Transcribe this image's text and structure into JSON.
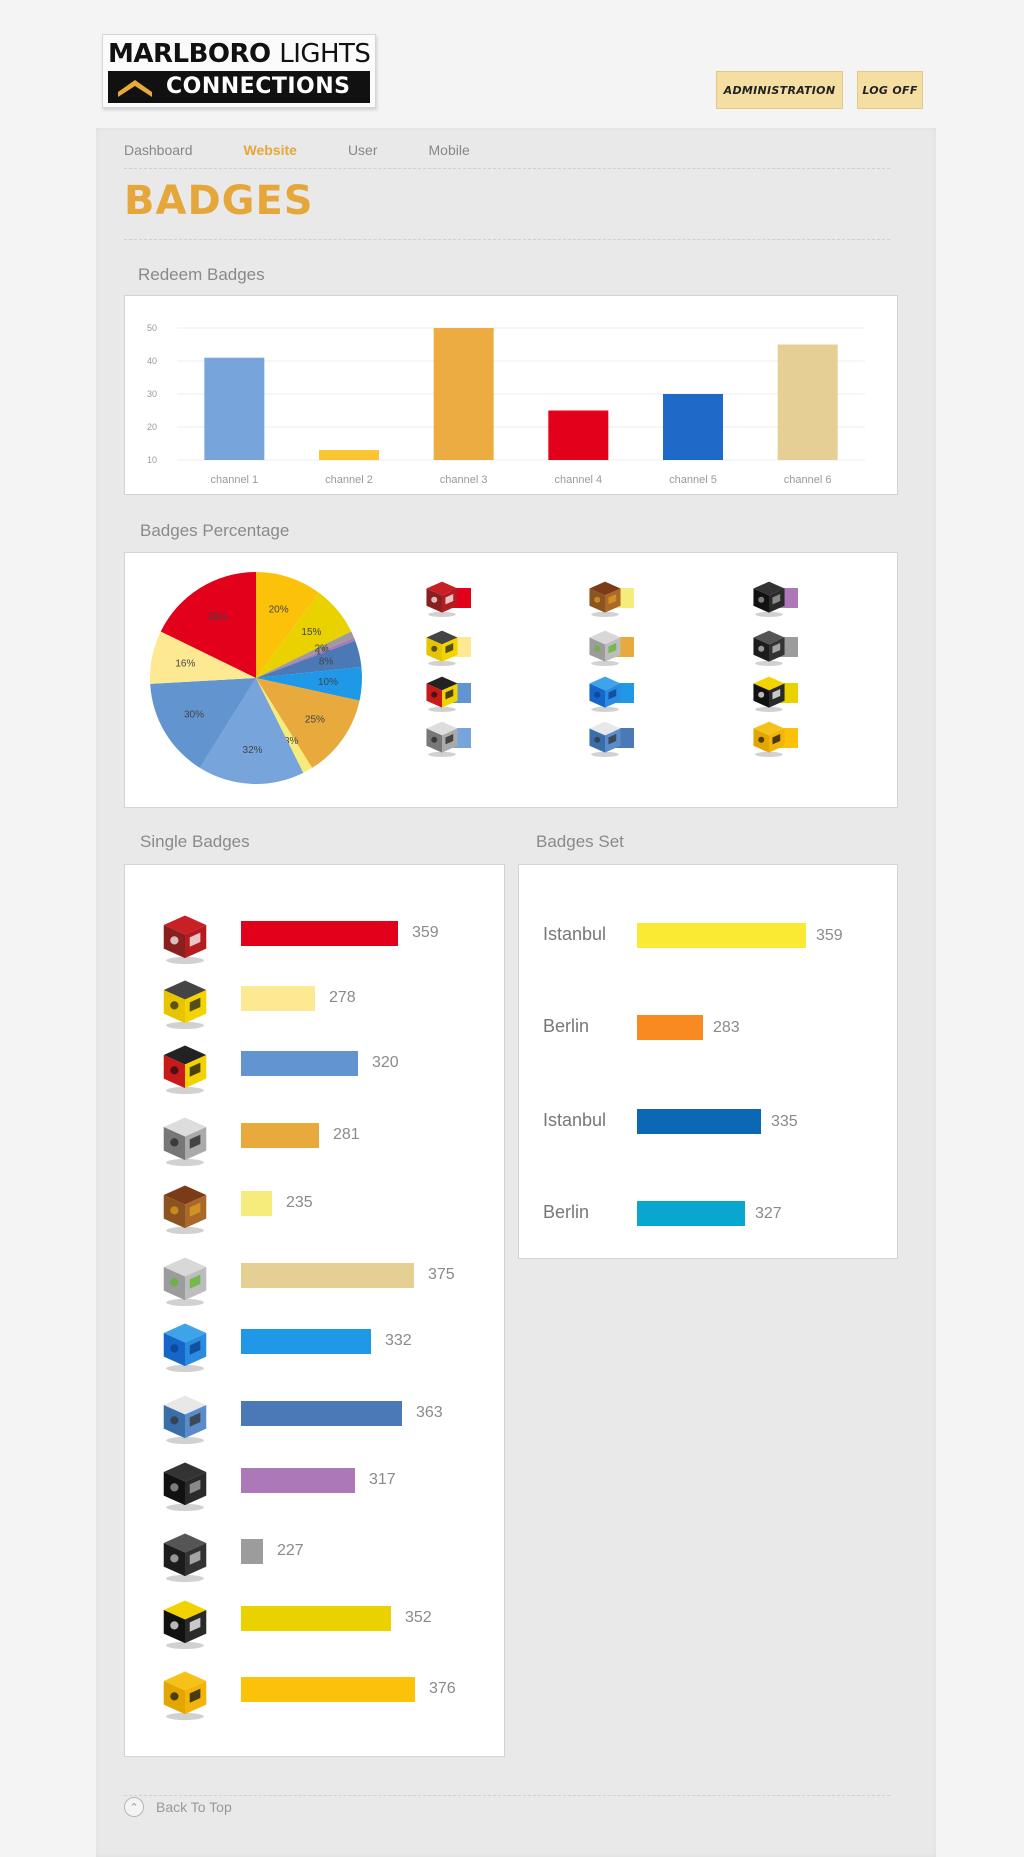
{
  "header": {
    "logo_line1_bold": "MARLBORO",
    "logo_line1_light": "LIGHTS",
    "logo_line2": "CONNECTIONS",
    "admin_label": "ADMINISTRATION",
    "logoff_label": "LOG OFF"
  },
  "nav": {
    "items": [
      {
        "label": "Dashboard",
        "active": false
      },
      {
        "label": "Website",
        "active": true
      },
      {
        "label": "User",
        "active": false
      },
      {
        "label": "Mobile",
        "active": false
      }
    ]
  },
  "page_title": "BADGES",
  "sections": {
    "redeem": "Redeem Badges",
    "percentage": "Badges Percentage",
    "single": "Single Badges",
    "set": "Badges Set"
  },
  "colors": {
    "accent": "#e5a73a",
    "red": "#e2001a",
    "light_yellow": "#fde991",
    "mid_blue": "#6294d0",
    "orange_gold": "#e8aa3c",
    "pale_yellow": "#f5ec7b",
    "tan": "#e5cf95",
    "sky_blue": "#1f98e8",
    "steel_blue": "#4a79b5",
    "purple": "#ad78b7",
    "gray": "#9c9c9c",
    "mustard": "#ead100",
    "amber": "#fcc20a"
  },
  "chart_data": [
    {
      "type": "bar",
      "title": "Redeem Badges",
      "categories": [
        "channel 1",
        "channel 2",
        "channel 3",
        "channel 4",
        "channel 5",
        "channel 6"
      ],
      "values": [
        41,
        13,
        50,
        25,
        30,
        45
      ],
      "colors": [
        "#78a4dc",
        "#fbc531",
        "#ecac41",
        "#e2001a",
        "#1f69c8",
        "#e5cf95"
      ],
      "yticks": [
        10,
        20,
        30,
        40,
        50
      ],
      "ylim": [
        10,
        50
      ],
      "grid": true
    },
    {
      "type": "pie",
      "title": "Badges Percentage",
      "slices": [
        {
          "label": "20%",
          "value": 20,
          "color": "#fcc20a"
        },
        {
          "label": "15%",
          "value": 15,
          "color": "#ead100"
        },
        {
          "label": "2%",
          "value": 2,
          "color": "#9c9c9c"
        },
        {
          "label": "1%",
          "value": 1,
          "color": "#ad78b7"
        },
        {
          "label": "8%",
          "value": 8,
          "color": "#4a79b5"
        },
        {
          "label": "10%",
          "value": 10,
          "color": "#1f98e8"
        },
        {
          "label": "25%",
          "value": 25,
          "color": "#e8aa3c"
        },
        {
          "label": "3%",
          "value": 3,
          "color": "#f5ec7b"
        },
        {
          "label": "32%",
          "value": 32,
          "color": "#78a4dc"
        },
        {
          "label": "30%",
          "value": 30,
          "color": "#6294d0"
        },
        {
          "label": "16%",
          "value": 16,
          "color": "#fde991"
        },
        {
          "label": "35%",
          "value": 35,
          "color": "#e2001a"
        }
      ]
    },
    {
      "type": "bar",
      "title": "Single Badges",
      "orientation": "horizontal",
      "values": [
        359,
        278,
        320,
        281,
        235,
        375,
        332,
        363,
        317,
        227,
        352,
        376
      ],
      "colors": [
        "#e2001a",
        "#fde991",
        "#6294d0",
        "#e8aa3c",
        "#f5ec7b",
        "#e5cf95",
        "#1f98e8",
        "#4a79b5",
        "#ad78b7",
        "#9c9c9c",
        "#ead100",
        "#fcc20a"
      ],
      "icons": [
        "food-cart-icon",
        "yellow-turntable-icon",
        "red-graffiti-cube-icon",
        "microphone-cube-icon",
        "wooden-crate-icon",
        "apple-glass-cube-icon",
        "blue-graffiti-cube-icon",
        "boxing-ring-icon",
        "retro-camera-icon",
        "film-camera-icon",
        "dj-booth-icon",
        "taxi-cube-icon"
      ]
    },
    {
      "type": "bar",
      "title": "Badges Set",
      "orientation": "horizontal",
      "categories": [
        "Istanbul",
        "Berlin",
        "Istanbul",
        "Berlin"
      ],
      "values": [
        359,
        283,
        335,
        327
      ],
      "colors": [
        "#fbea33",
        "#f98a22",
        "#0b68b5",
        "#09a6d0"
      ]
    }
  ],
  "legend": [
    {
      "icon": "food-cart-icon",
      "color": "#e2001a"
    },
    {
      "icon": "wooden-crate-icon",
      "color": "#f5ec7b"
    },
    {
      "icon": "retro-camera-icon",
      "color": "#ad78b7"
    },
    {
      "icon": "yellow-turntable-icon",
      "color": "#fde991"
    },
    {
      "icon": "apple-glass-cube-icon",
      "color": "#e8aa3c"
    },
    {
      "icon": "film-camera-icon",
      "color": "#9c9c9c"
    },
    {
      "icon": "red-graffiti-cube-icon",
      "color": "#6294d0"
    },
    {
      "icon": "blue-graffiti-cube-icon",
      "color": "#1f98e8"
    },
    {
      "icon": "dj-booth-icon",
      "color": "#ead100"
    },
    {
      "icon": "microphone-cube-icon",
      "color": "#78a4dc"
    },
    {
      "icon": "boxing-ring-icon",
      "color": "#4a79b5"
    },
    {
      "icon": "taxi-cube-icon",
      "color": "#fcc20a"
    }
  ],
  "footer": {
    "back_to_top": "Back To Top"
  }
}
